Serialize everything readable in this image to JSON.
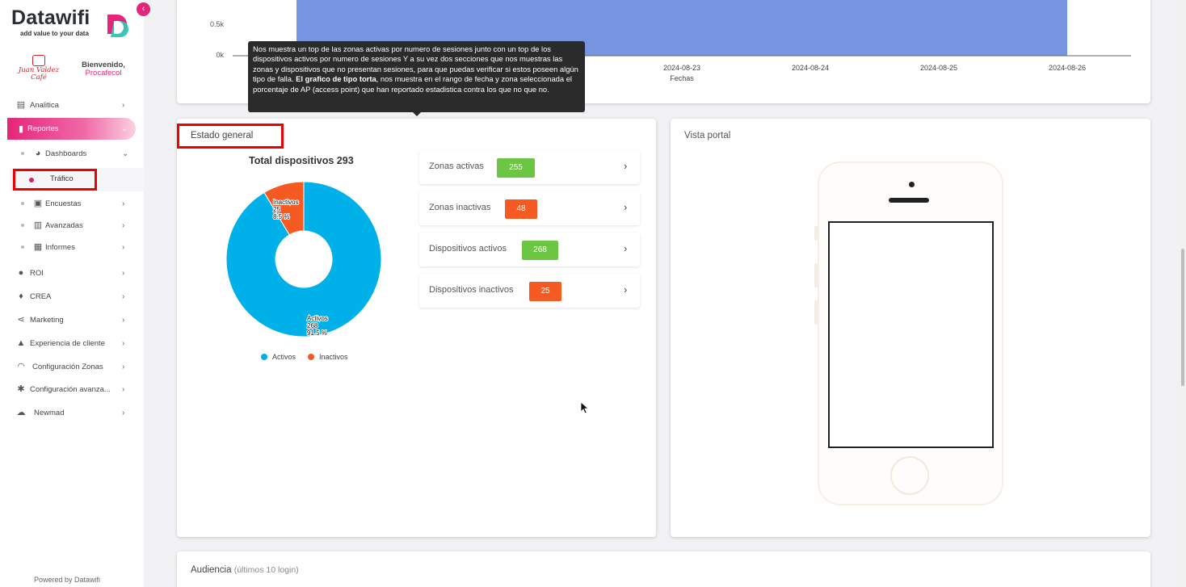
{
  "app": {
    "logo_text": "Datawifi",
    "logo_reg": "®",
    "tagline": "add value to your data",
    "brand_line1": "Juan Valdez",
    "brand_line2": "Café"
  },
  "welcome": {
    "line1": "Bienvenido,",
    "line2": "Procafecol"
  },
  "sidebar": {
    "items": [
      {
        "label": "Analitica",
        "icon": "bar-chart-icon"
      },
      {
        "label": "Reportes",
        "icon": "document-icon"
      },
      {
        "label": "Dashboards",
        "icon": "gauge-icon"
      },
      {
        "label": "Tráfico",
        "icon": "dot-icon"
      },
      {
        "label": "Encuestas",
        "icon": "clipboard-icon"
      },
      {
        "label": "Avanzadas",
        "icon": "bars-icon"
      },
      {
        "label": "Informes",
        "icon": "book-icon"
      },
      {
        "label": "ROI",
        "icon": "user-icon"
      },
      {
        "label": "CREA",
        "icon": "bulb-icon"
      },
      {
        "label": "Marketing",
        "icon": "share-icon"
      },
      {
        "label": "Experiencia de cliente",
        "icon": "thumbs-up-icon"
      },
      {
        "label": "Configuración Zonas",
        "icon": "wifi-icon"
      },
      {
        "label": "Configuración avanza...",
        "icon": "gear-icon"
      },
      {
        "label": "Newmad",
        "icon": "cloud-icon"
      }
    ],
    "powered_by": "Powered by Datawifi"
  },
  "chart_data": {
    "type": "bar",
    "yticks": [
      "0.5k",
      "0k"
    ],
    "xticks": [
      "2024-08-23",
      "2024-08-24",
      "2024-08-25",
      "2024-08-26"
    ],
    "xlabel": "Fechas",
    "bar_color": "#7694e0"
  },
  "tooltip": {
    "text_part1": "Nos muestra un top de las zonas activas por numero de sesiones junto con un top de los dispositivos activos por numero de sesiones Y a su vez dos secciones que nos muestras las zonas y dispositivos que no presentan sesiones, para que puedas verificar si estos poseen algún tipo de falla. ",
    "bold_part": "El grafico de tipo torta",
    "text_part2": ", nos muestra en el rango de fecha y zona seleccionada el porcentaje de AP (access point) que han reportado estadistica contra los que no que no."
  },
  "estado": {
    "title": "Estado general",
    "donut_title": "Total dispositivos 293",
    "activos": {
      "label": "Activos",
      "count": "268",
      "pct": "91.5 %",
      "value": 268,
      "color": "#00b0e8"
    },
    "inactivos": {
      "label": "Inactivos",
      "count": "25",
      "pct": "8.5 %",
      "value": 25,
      "color": "#f45a22"
    },
    "legend": [
      "Activos",
      "Inactivos"
    ]
  },
  "stats": [
    {
      "label": "Zonas activas",
      "value": "255",
      "color": "#6cc644"
    },
    {
      "label": "Zonas inactivas",
      "value": "48",
      "color": "#f45a22"
    },
    {
      "label": "Dispositivos activos",
      "value": "268",
      "color": "#6cc644"
    },
    {
      "label": "Dispositivos inactivos",
      "value": "25",
      "color": "#f45a22"
    }
  ],
  "portal": {
    "title": "Vista portal"
  },
  "audiencia": {
    "title": "Audiencia",
    "subtitle": "(últimos 10 login)"
  },
  "colors": {
    "accent": "#e5257a",
    "highlight": "#ec0000"
  }
}
